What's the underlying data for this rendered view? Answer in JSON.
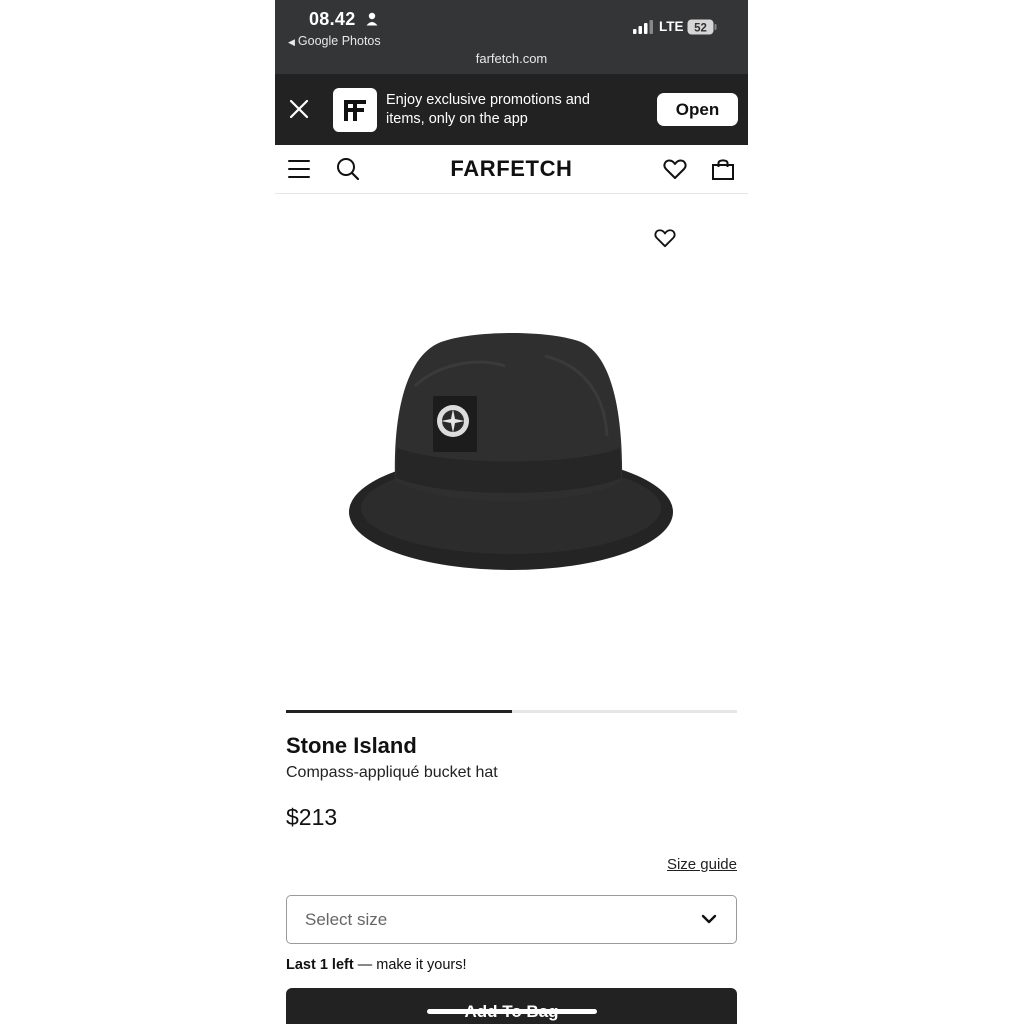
{
  "status_bar": {
    "time": "08.42",
    "back_app": "Google Photos",
    "url": "farfetch.com",
    "network": "LTE",
    "battery": "52"
  },
  "app_banner": {
    "promo_text": "Enjoy exclusive promotions and items, only on the app",
    "open_label": "Open"
  },
  "header": {
    "brand": "FARFETCH"
  },
  "product": {
    "carousel_progress": 0.5,
    "brand": "Stone Island",
    "description": "Compass-appliqué bucket hat",
    "price": "$213",
    "size_guide": "Size guide",
    "size_placeholder": "Select size",
    "stock_emphasis": "Last 1 left",
    "stock_rest": " — make it yours!",
    "add_to_bag": "Add To Bag"
  },
  "colors": {
    "status_bar_bg": "#333537",
    "banner_bg": "#222222",
    "button_bg": "#222222"
  }
}
